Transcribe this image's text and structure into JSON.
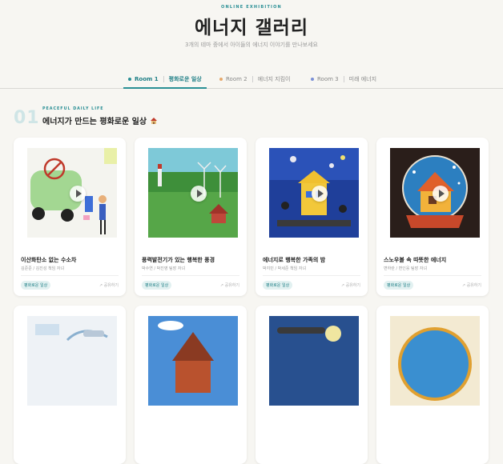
{
  "header": {
    "eyebrow": "ONLINE EXHIBITION",
    "title": "에너지 갤러리",
    "subtitle": "3개의 테마 중에서 아이들의 에너지 이야기를 만나보세요"
  },
  "tabs": [
    {
      "label": "Room 1",
      "name": "평화로운 일상",
      "color": "#2a8f95",
      "active": true
    },
    {
      "label": "Room 2",
      "name": "에너지 지킴이",
      "color": "#e6a86b",
      "active": false
    },
    {
      "label": "Room 3",
      "name": "미래 에너지",
      "color": "#7a8fd6",
      "active": false
    }
  ],
  "section": {
    "number": "01",
    "eyebrow": "PEACEFUL DAILY LIFE",
    "title": "에너지가 만드는 평화로운 일상",
    "icon": "house-icon"
  },
  "cards": [
    {
      "title": "이산화탄소 없는 수소차",
      "author": "김준준 / 김진성 책임 자녀",
      "badge": "평화로운 일상",
      "share": "↗ 공유하기"
    },
    {
      "title": "풍력발전기가 있는 행복한 풍경",
      "author": "박수연 / 박진영 팀장 자녀",
      "badge": "평화로운 일상",
      "share": "↗ 공유하기"
    },
    {
      "title": "에너지로 행복한 가족의 밤",
      "author": "박지민 / 박세준 책임 자녀",
      "badge": "평화로운 일상",
      "share": "↗ 공유하기"
    },
    {
      "title": "스노우볼 속 따뜻한 에너지",
      "author": "변하란 / 변인웅 팀장 자녀",
      "badge": "평화로운 일상",
      "share": "↗ 공유하기"
    }
  ],
  "colors": {
    "accent": "#2a8f95",
    "background": "#f7f6f2"
  }
}
